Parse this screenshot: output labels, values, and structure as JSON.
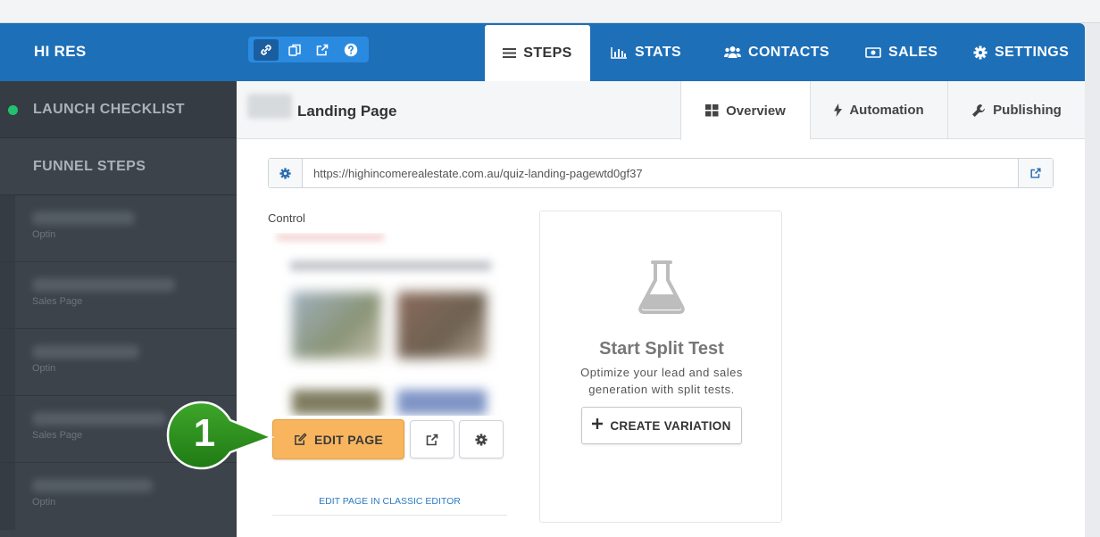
{
  "header": {
    "brand": "HI RES",
    "tools": [
      "link-icon",
      "copy-icon",
      "external-link-icon",
      "help-icon"
    ],
    "tabs": [
      {
        "label": "STEPS",
        "icon": "bars-icon",
        "active": true
      },
      {
        "label": "STATS",
        "icon": "bar-chart-icon",
        "active": false
      },
      {
        "label": "CONTACTS",
        "icon": "users-icon",
        "active": false
      },
      {
        "label": "SALES",
        "icon": "money-icon",
        "active": false
      },
      {
        "label": "SETTINGS",
        "icon": "gear-icon",
        "active": false
      }
    ]
  },
  "sidebar": {
    "launch": "LAUNCH CHECKLIST",
    "funnel": "FUNNEL STEPS",
    "steps": [
      {
        "type": "Optin"
      },
      {
        "type": "Sales Page"
      },
      {
        "type": "Optin"
      },
      {
        "type": "Sales Page"
      },
      {
        "type": "Optin"
      }
    ]
  },
  "page": {
    "title": "Landing Page",
    "tabs": [
      {
        "label": "Overview",
        "icon": "grid-icon"
      },
      {
        "label": "Automation",
        "icon": "bolt-icon"
      },
      {
        "label": "Publishing",
        "icon": "wrench-icon"
      }
    ],
    "url": "https://highincomerealestate.com.au/quiz-landing-pagewtd0gf37",
    "control_label": "Control",
    "edit_label": "EDIT PAGE",
    "classic_link": "EDIT PAGE IN CLASSIC EDITOR"
  },
  "split": {
    "title": "Start Split Test",
    "desc": "Optimize your lead and sales generation with split tests.",
    "button": "CREATE VARIATION"
  },
  "callout": {
    "number": "1",
    "color": "#2e8b1e"
  },
  "colors": {
    "header": "#1d6fb8",
    "sidebar": "#3c434b",
    "edit_button": "#f9b55d",
    "status_dot": "#22c16d"
  }
}
